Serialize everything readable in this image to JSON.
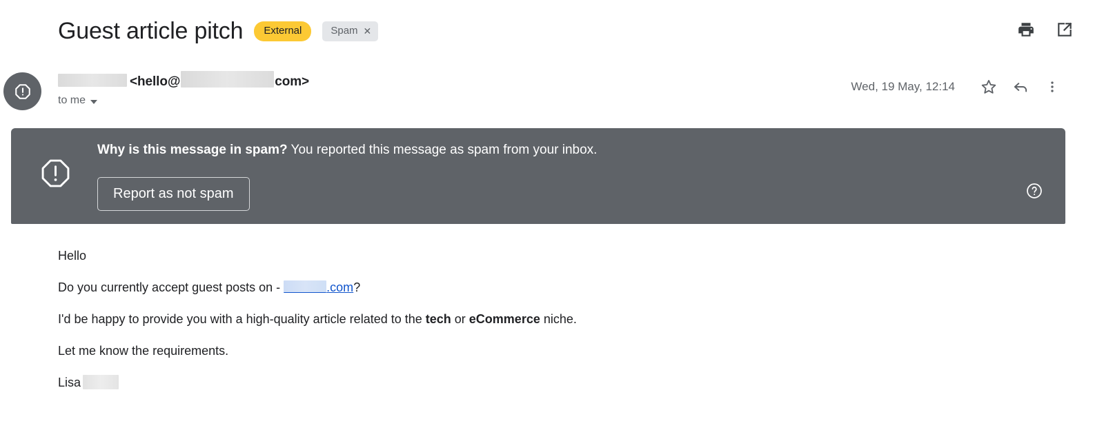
{
  "header": {
    "subject": "Guest article pitch",
    "badge_external": "External",
    "chip_spam": "Spam",
    "chip_spam_close": "✕",
    "print_icon": "print-icon",
    "open_new_window_icon": "open-in-new-icon"
  },
  "sender": {
    "avatar_icon": "spam-octagon-icon",
    "name_redacted": "",
    "email": "<hello@",
    "email_tail": "com>",
    "recipients": "to me",
    "date": "Wed, 19 May, 12:14",
    "star_icon": "star-outline-icon",
    "reply_icon": "reply-arrow-icon",
    "more_icon": "more-vertical-icon"
  },
  "spam_banner": {
    "icon": "warning-octagon-icon",
    "question": "Why is this message in spam?",
    "explanation": "You reported this message as spam from your inbox.",
    "button_label": "Report as not spam",
    "help_icon": "help-circle-icon",
    "background_color": "#5f6368"
  },
  "message_body": {
    "greeting": "Hello",
    "line2_before": "Do you currently accept guest posts on - ",
    "line2_link": ".com",
    "line2_after": "?",
    "line3_a": "I'd be happy to provide you with a high-quality article related to the ",
    "line3_bold1": "tech",
    "line3_b": " or ",
    "line3_bold2": "eCommerce",
    "line3_c": " niche.",
    "line4": "Let me know the requirements.",
    "signature": "Lisa"
  },
  "colors": {
    "accent_external": "#fcc934",
    "banner_gray": "#5f6368",
    "link_blue": "#1155cc",
    "chip_gray": "#e4e6e9"
  }
}
